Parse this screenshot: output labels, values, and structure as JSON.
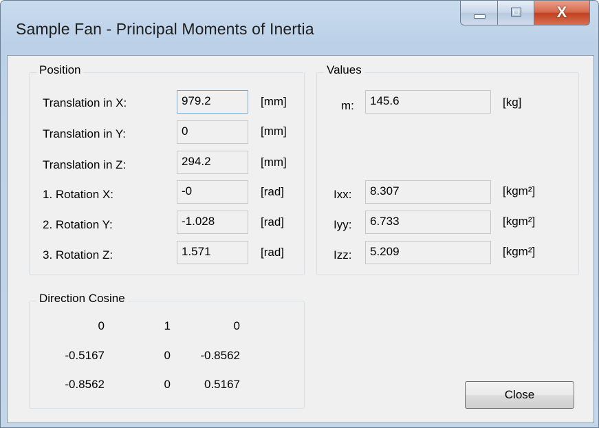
{
  "window": {
    "title": "Sample Fan - Principal Moments of Inertia"
  },
  "caption_buttons": {
    "close_glyph": "X"
  },
  "position": {
    "title": "Position",
    "rows": [
      {
        "label": "Translation in X:",
        "value": "979.2",
        "unit": "[mm]"
      },
      {
        "label": "Translation in Y:",
        "value": "0",
        "unit": "[mm]"
      },
      {
        "label": "Translation in Z:",
        "value": "294.2",
        "unit": "[mm]"
      },
      {
        "label": "1. Rotation  X:",
        "value": "-0",
        "unit": "[rad]"
      },
      {
        "label": "2. Rotation  Y:",
        "value": "-1.028",
        "unit": "[rad]"
      },
      {
        "label": "3. Rotation  Z:",
        "value": "1.571",
        "unit": "[rad]"
      }
    ]
  },
  "values": {
    "title": "Values",
    "mass": {
      "label": "m:",
      "value": "145.6",
      "unit": "[kg]"
    },
    "rows": [
      {
        "label": "Ixx:",
        "value": "8.307",
        "unit": "[kgm²]"
      },
      {
        "label": "Iyy:",
        "value": "6.733",
        "unit": "[kgm²]"
      },
      {
        "label": "Izz:",
        "value": "5.209",
        "unit": "[kgm²]"
      }
    ]
  },
  "direction_cosine": {
    "title": "Direction Cosine",
    "matrix": [
      [
        "0",
        "1",
        "0"
      ],
      [
        "-0.5167",
        "0",
        "-0.8562"
      ],
      [
        "-0.8562",
        "0",
        "0.5167"
      ]
    ]
  },
  "buttons": {
    "close": "Close"
  },
  "colors": {
    "title_bar": "#bcd1e8",
    "close_caption": "#c23e1f",
    "client_bg": "#f0f0f0"
  }
}
